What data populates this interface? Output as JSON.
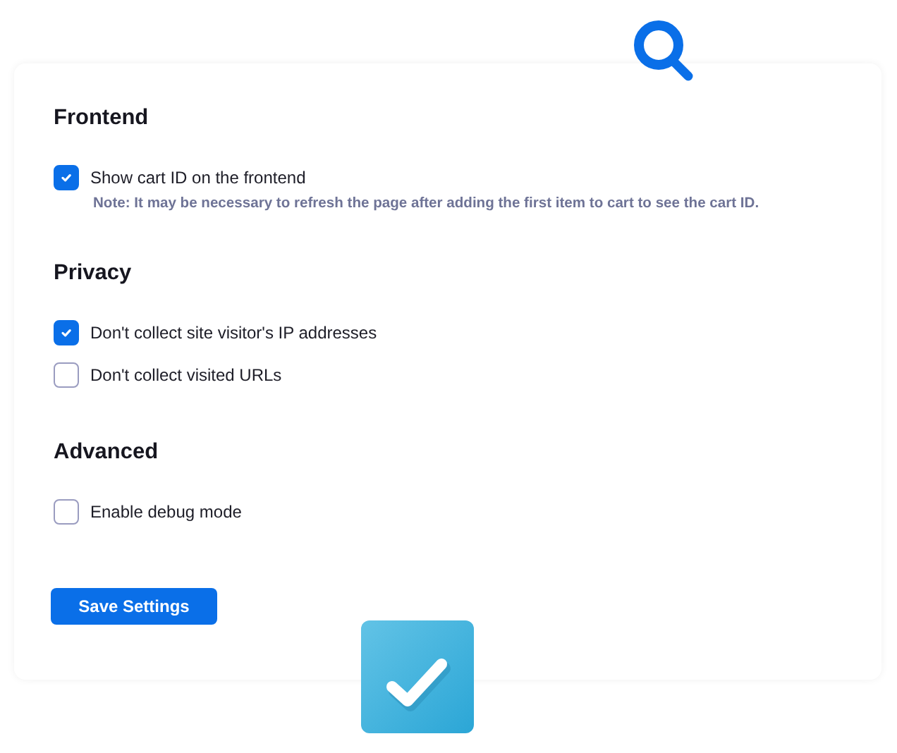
{
  "sections": [
    {
      "title": "Frontend",
      "options": [
        {
          "label": "Show cart ID on the frontend",
          "checked": true,
          "note": "Note: It may be necessary to refresh the page after adding the first item to cart to see the cart ID."
        }
      ]
    },
    {
      "title": "Privacy",
      "options": [
        {
          "label": "Don't collect site visitor's IP addresses",
          "checked": true
        },
        {
          "label": "Don't collect visited URLs",
          "checked": false
        }
      ]
    },
    {
      "title": "Advanced",
      "options": [
        {
          "label": "Enable debug mode",
          "checked": false
        }
      ]
    }
  ],
  "save_button": "Save Settings"
}
